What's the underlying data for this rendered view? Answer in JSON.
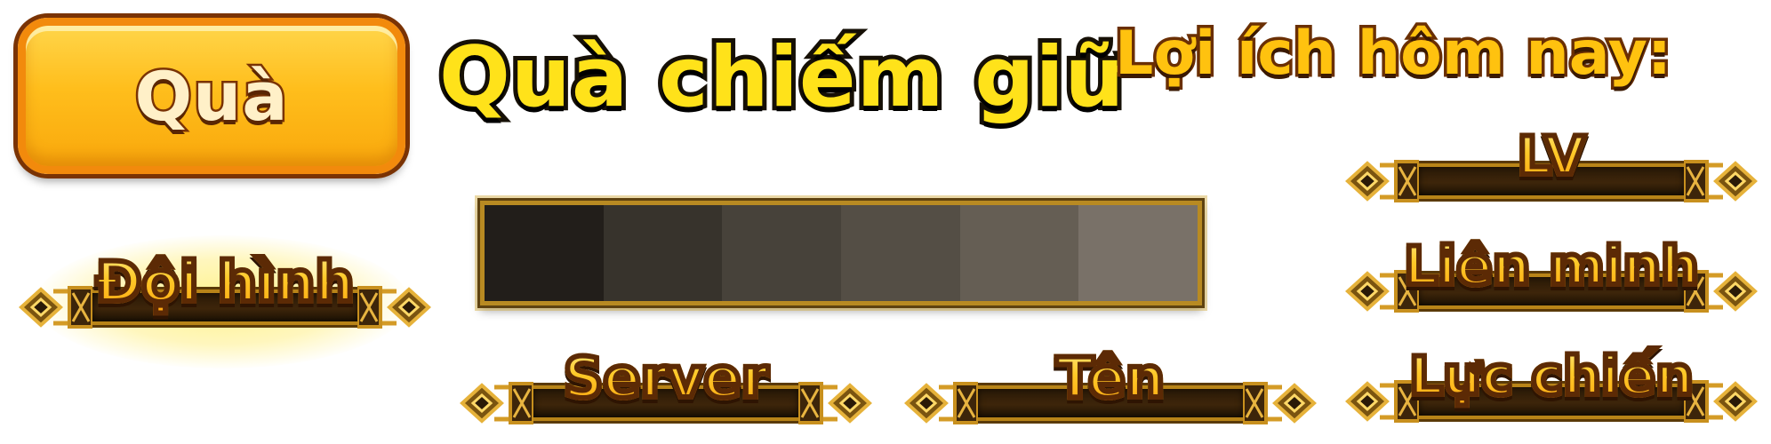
{
  "gift_button": {
    "label": "Quà"
  },
  "occupied_title": "Quà chiếm giữ",
  "benefits": {
    "title": "Lợi ích hôm nay:",
    "items": [
      {
        "label": "LV"
      },
      {
        "label": "Liên minh"
      },
      {
        "label": "Lực chiến"
      }
    ]
  },
  "formation": {
    "label": "Đội hình"
  },
  "progress": {
    "segment_colors": [
      "#221e1a",
      "#37332c",
      "#47423a",
      "#544e45",
      "#655e54",
      "#797168"
    ]
  },
  "columns": [
    {
      "label": "Server"
    },
    {
      "label": "Tên"
    }
  ],
  "colors": {
    "gold_text": "#ffc20f",
    "title_yellow": "#ffe21a",
    "button_orange": "#ffbe1c",
    "frame_gold": "#b88418"
  }
}
